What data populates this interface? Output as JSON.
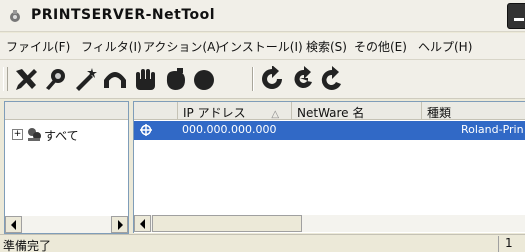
{
  "window": {
    "title": "PRINTSERVER-NetTool"
  },
  "menu": [
    {
      "label": "ファイル(F)"
    },
    {
      "label": "フィルタ(I)"
    },
    {
      "label": "アクション(A)"
    },
    {
      "label": "インストール(I)"
    },
    {
      "label": "検索(S)"
    },
    {
      "label": "その他(E)"
    },
    {
      "label": "ヘルプ(H)"
    }
  ],
  "toolbar": {
    "icons": [
      "tools-icon",
      "search-icon",
      "wand-icon",
      "undo-icon",
      "hand-icon",
      "eraser-icon",
      "circle-icon",
      "refresh-icon",
      "refresh-back-icon",
      "refresh-forward-icon"
    ]
  },
  "tree": {
    "expander": "+",
    "items": [
      {
        "label": "すべて"
      }
    ]
  },
  "list": {
    "columns": [
      "",
      "IP アドレス",
      "NetWare 名",
      "種類"
    ],
    "sort_indicator": "△",
    "rows": [
      {
        "ip": "000.000.000.000",
        "netware": "",
        "type": "Roland-Prin"
      }
    ]
  },
  "status": {
    "text": "準備完了",
    "pane": "1"
  },
  "colors": {
    "selection": "#3169c6",
    "chrome": "#ece9d8",
    "border": "#7f9db9"
  }
}
